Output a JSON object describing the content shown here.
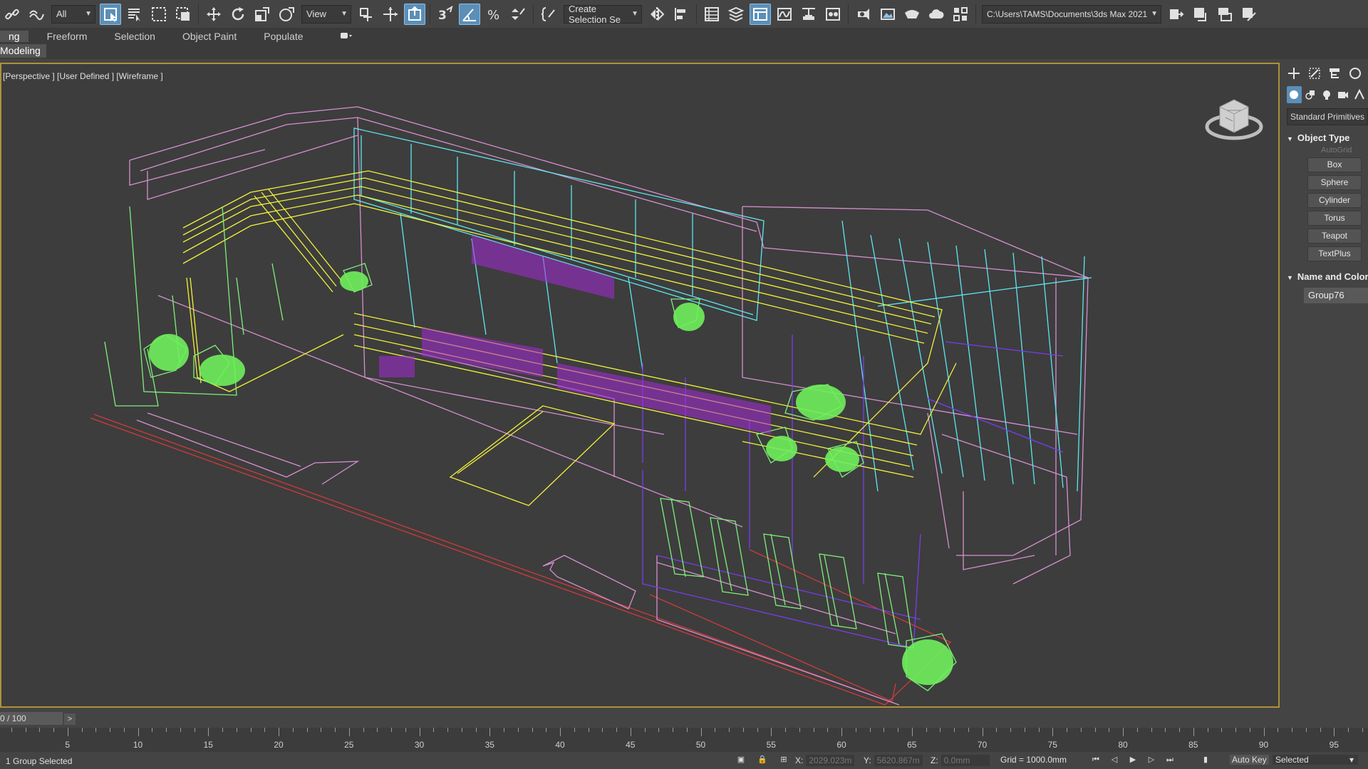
{
  "toolbar": {
    "selection_filter": "All",
    "ref_coord": "View",
    "named_selection": "Create Selection Se",
    "project_path": "C:\\Users\\TAMS\\Documents\\3ds Max 2021"
  },
  "ribbon": {
    "tabs": [
      "ng",
      "Freeform",
      "Selection",
      "Object Paint",
      "Populate"
    ],
    "sub_label": "Modeling"
  },
  "viewport": {
    "label": "[Perspective ] [User Defined ] [Wireframe ]"
  },
  "command_panel": {
    "category": "Standard Primitives",
    "object_type_title": "Object Type",
    "autogrid_label": "AutoGrid",
    "buttons": [
      "Box",
      "Sphere",
      "Cylinder",
      "Torus",
      "Teapot",
      "TextPlus"
    ],
    "name_color_title": "Name and Color",
    "object_name": "Group76"
  },
  "timeline": {
    "frame_display": "0 / 100",
    "next_label": ">",
    "ticks": [
      "5",
      "10",
      "15",
      "20",
      "25",
      "30",
      "35",
      "40",
      "45",
      "50",
      "55",
      "60",
      "65",
      "70",
      "75",
      "80",
      "85",
      "90",
      "95"
    ]
  },
  "status": {
    "message": "1 Group Selected",
    "x_label": "X:",
    "x_value": "2029.023m",
    "y_label": "Y:",
    "y_value": "5620.867m",
    "z_label": "Z:",
    "z_value": "0.0mm",
    "grid": "Grid = 1000.0mm",
    "auto_key": "Auto Key",
    "key_filter": "Selected"
  },
  "colors": {
    "accent_active": "#5b8fb8",
    "viewport_border": "#b09038",
    "wire_yellow": "#f2f23a",
    "wire_cyan": "#5ee6f0",
    "wire_pink": "#d78fd0",
    "wire_purple": "#7a3cf0",
    "wire_green": "#7ef07a",
    "wire_red": "#d23a3a"
  }
}
